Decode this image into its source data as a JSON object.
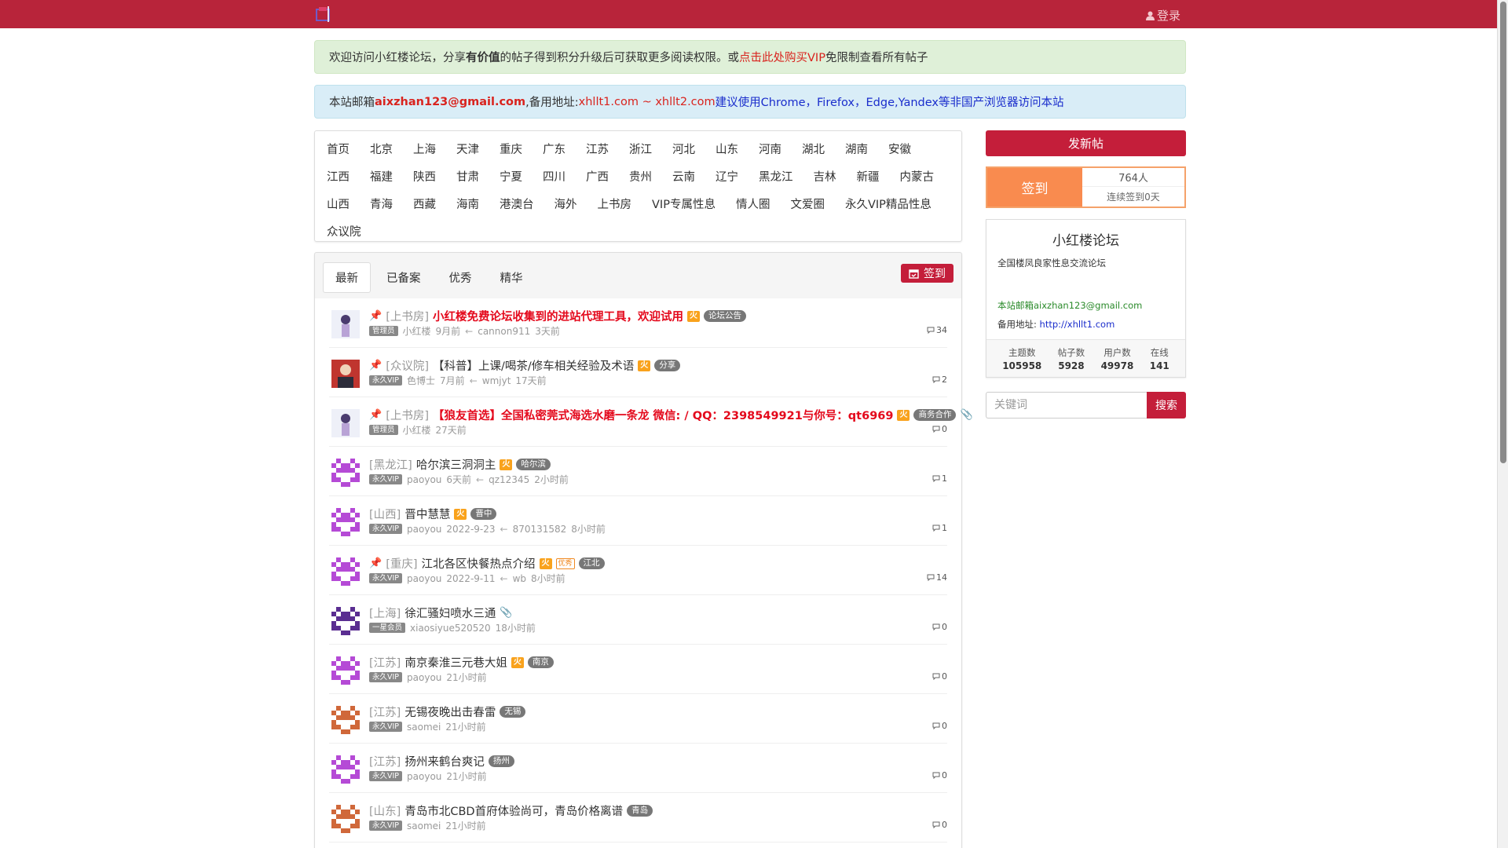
{
  "header": {
    "login_label": "登录",
    "logo_icon": "forum-logo-icon",
    "brand_color": "#b8243a"
  },
  "notice_welcome": {
    "p1": "欢迎访问小红楼论坛，分享",
    "p2": "有价值",
    "p3": "的帖子得到积分升级后可获取更多阅读权限。或",
    "p4": "点击此处购买VIP",
    "p5": "免限制查看所有帖子"
  },
  "notice_mail": {
    "p1": "本站邮箱",
    "p2": "aixzhan123@gmail.com",
    "p3": ",备用地址: ",
    "p4": "xhllt1.com ~ xhllt2.com",
    "p5": " 建议使用Chrome，Firefox，Edge,Yandex等非国产浏览器访问本站"
  },
  "categories": {
    "row1": [
      "首页",
      "北京",
      "上海",
      "天津",
      "重庆",
      "广东",
      "江苏",
      "浙江",
      "河北",
      "山东",
      "河南",
      "湖北",
      "湖南",
      "安徽"
    ],
    "row2": [
      "江西",
      "福建",
      "陕西",
      "甘肃",
      "宁夏",
      "四川",
      "广西",
      "贵州",
      "云南",
      "辽宁",
      "黑龙江",
      "吉林",
      "新疆",
      "内蒙古"
    ],
    "row3": [
      "山西",
      "青海",
      "西藏",
      "海南",
      "港澳台",
      "海外",
      "上书房",
      "VIP专属性息",
      "情人圈",
      "文爱圈",
      "永久VIP精品性息"
    ],
    "row4": [
      "众议院"
    ]
  },
  "tabs": [
    "最新",
    "已备案",
    "优秀",
    "精华"
  ],
  "sign_small": "签到",
  "posts": [
    {
      "pin": "pink",
      "cat": "[上书房]",
      "title": "小红楼免费论坛收集到的进站代理工具，欢迎试用",
      "hot": true,
      "fire": "火",
      "tag": "论坛公告",
      "role": "管理员",
      "author": "小红楼",
      "time": "9月前",
      "last_user": "cannon911",
      "last_time": "3天前",
      "replies": "34",
      "avatar": "girl"
    },
    {
      "pin": "pink",
      "cat": "[众议院]",
      "title": "【科普】上课/喝茶/修车相关经验及术语",
      "hot": false,
      "fire": "火",
      "tag": "分享",
      "role": "永久VIP",
      "author": "色博士",
      "time": "7月前",
      "last_user": "wmjyt",
      "last_time": "17天前",
      "replies": "2",
      "avatar": "man"
    },
    {
      "pin": "pink",
      "cat": "[上书房]",
      "title": "【狼友首选】全国私密莞式海选水磨一条龙 微信: / QQ：2398549921与你号：qt6969",
      "hot": true,
      "fire": "火",
      "tag": "商务合作",
      "clip": true,
      "role": "管理员",
      "author": "小红楼",
      "time": "27天前",
      "last_user": "",
      "last_time": "",
      "replies": "0",
      "avatar": "girl"
    },
    {
      "pin": "",
      "cat": "[黑龙江]",
      "title": "哈尔滨三洞洞主",
      "hot": false,
      "fire": "火",
      "tag": "哈尔滨",
      "role": "永久VIP",
      "author": "paoyou",
      "time": "6天前",
      "last_user": "qz12345",
      "last_time": "2小时前",
      "replies": "1",
      "avatar": "pixel-purple"
    },
    {
      "pin": "",
      "cat": "[山西]",
      "title": "晋中慧慧",
      "hot": false,
      "fire": "火",
      "tag": "晋中",
      "role": "永久VIP",
      "author": "paoyou",
      "time": "2022-9-23",
      "last_user": "870131582",
      "last_time": "8小时前",
      "replies": "1",
      "avatar": "pixel-purple"
    },
    {
      "pin": "orange",
      "cat": "[重庆]",
      "title": "江北各区快餐热点介绍",
      "hot": false,
      "fire": "火",
      "yx": "优秀",
      "tag": "江北",
      "role": "永久VIP",
      "author": "paoyou",
      "time": "2022-9-11",
      "last_user": "wb",
      "last_time": "8小时前",
      "replies": "14",
      "avatar": "pixel-purple"
    },
    {
      "pin": "",
      "cat": "[上海]",
      "title": "徐汇骚妇喷水三通",
      "hot": false,
      "clip": true,
      "role": "一星会员",
      "author": "xiaosiyue520520",
      "time": "18小时前",
      "last_user": "",
      "last_time": "",
      "replies": "0",
      "avatar": "pixel-dark"
    },
    {
      "pin": "",
      "cat": "[江苏]",
      "title": "南京秦淮三元巷大姐",
      "hot": false,
      "fire": "火",
      "tag": "南京",
      "role": "永久VIP",
      "author": "paoyou",
      "time": "21小时前",
      "last_user": "",
      "last_time": "",
      "replies": "0",
      "avatar": "pixel-purple"
    },
    {
      "pin": "",
      "cat": "[江苏]",
      "title": "无锡夜晚出击春雷",
      "hot": false,
      "tag": "无锡",
      "role": "永久VIP",
      "author": "saomei",
      "time": "21小时前",
      "last_user": "",
      "last_time": "",
      "replies": "0",
      "avatar": "pixel-orange"
    },
    {
      "pin": "",
      "cat": "[江苏]",
      "title": "扬州来鹤台爽记",
      "hot": false,
      "tag": "扬州",
      "role": "永久VIP",
      "author": "paoyou",
      "time": "21小时前",
      "last_user": "",
      "last_time": "",
      "replies": "0",
      "avatar": "pixel-purple"
    },
    {
      "pin": "",
      "cat": "[山东]",
      "title": "青岛市北CBD首府体验尚可，青岛价格离谱",
      "hot": false,
      "tag": "青岛",
      "role": "永久VIP",
      "author": "saomei",
      "time": "21小时前",
      "last_user": "",
      "last_time": "",
      "replies": "0",
      "avatar": "pixel-orange"
    }
  ],
  "sidebar": {
    "new_post": "发新帖",
    "sign_label": "签到",
    "sign_count": "764人",
    "sign_days": "连续签到0天",
    "forum_name": "小红楼论坛",
    "forum_desc": "全国楼凤良家性息交流论坛",
    "forum_mail": "本站邮箱aixzhan123@gmail.com",
    "backup_label": "备用地址: ",
    "backup_url": "http://xhllt1.com",
    "stats": [
      {
        "label": "主题数",
        "value": "105958"
      },
      {
        "label": "帖子数",
        "value": "5928"
      },
      {
        "label": "用户数",
        "value": "49978"
      },
      {
        "label": "在线",
        "value": "141"
      }
    ],
    "search_placeholder": "关键词",
    "search_button": "搜索"
  }
}
